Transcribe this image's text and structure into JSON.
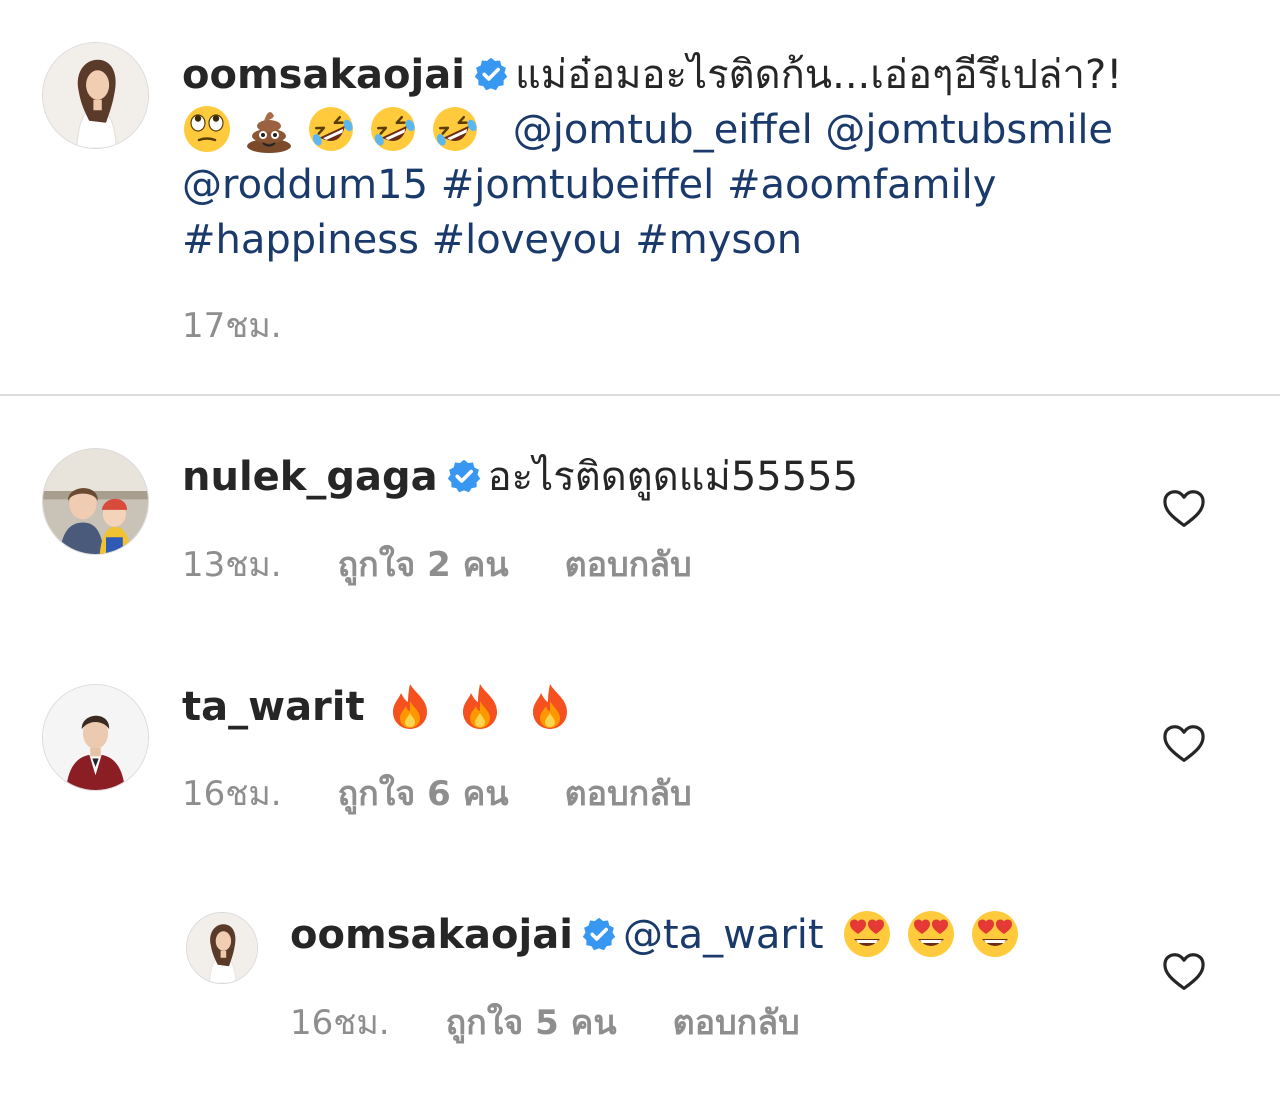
{
  "caption": {
    "username": "oomsakaojai",
    "text": "แม่อ๋อมอะไรติดก้น...เอ่อๆอีรึเปล่า?!",
    "mentions": [
      "@jomtub_eiffel",
      "@jomtubsmile",
      "@roddum15"
    ],
    "hashtags_line1": "#jomtubeiffel #aoomfamily",
    "hashtags_line2": "#happiness #loveyou #myson",
    "emojis": [
      "eye-roll-emoji",
      "poop-emoji",
      "rofl-emoji",
      "rofl-emoji",
      "rofl-emoji"
    ],
    "time": "17ชม."
  },
  "comments": [
    {
      "username": "nulek_gaga",
      "text": "อะไรติดตูดแม่55555",
      "time": "13ชม.",
      "likes": "ถูกใจ 2 คน",
      "reply": "ตอบกลับ"
    },
    {
      "username": "ta_warit",
      "emojis": [
        "fire-emoji",
        "fire-emoji",
        "fire-emoji"
      ],
      "time": "16ชม.",
      "likes": "ถูกใจ 6 คน",
      "reply": "ตอบกลับ"
    },
    {
      "username": "oomsakaojai",
      "mention": "@ta_warit",
      "emojis": [
        "heart-eyes-emoji",
        "heart-eyes-emoji",
        "heart-eyes-emoji"
      ],
      "time": "16ชม.",
      "likes": "ถูกใจ 5 คน",
      "reply": "ตอบกลับ"
    }
  ],
  "colors": {
    "text": "#262626",
    "link": "#1a3a6b",
    "meta": "#8e8e8e",
    "verified": "#3897f0",
    "divider": "#dbdbdb"
  }
}
